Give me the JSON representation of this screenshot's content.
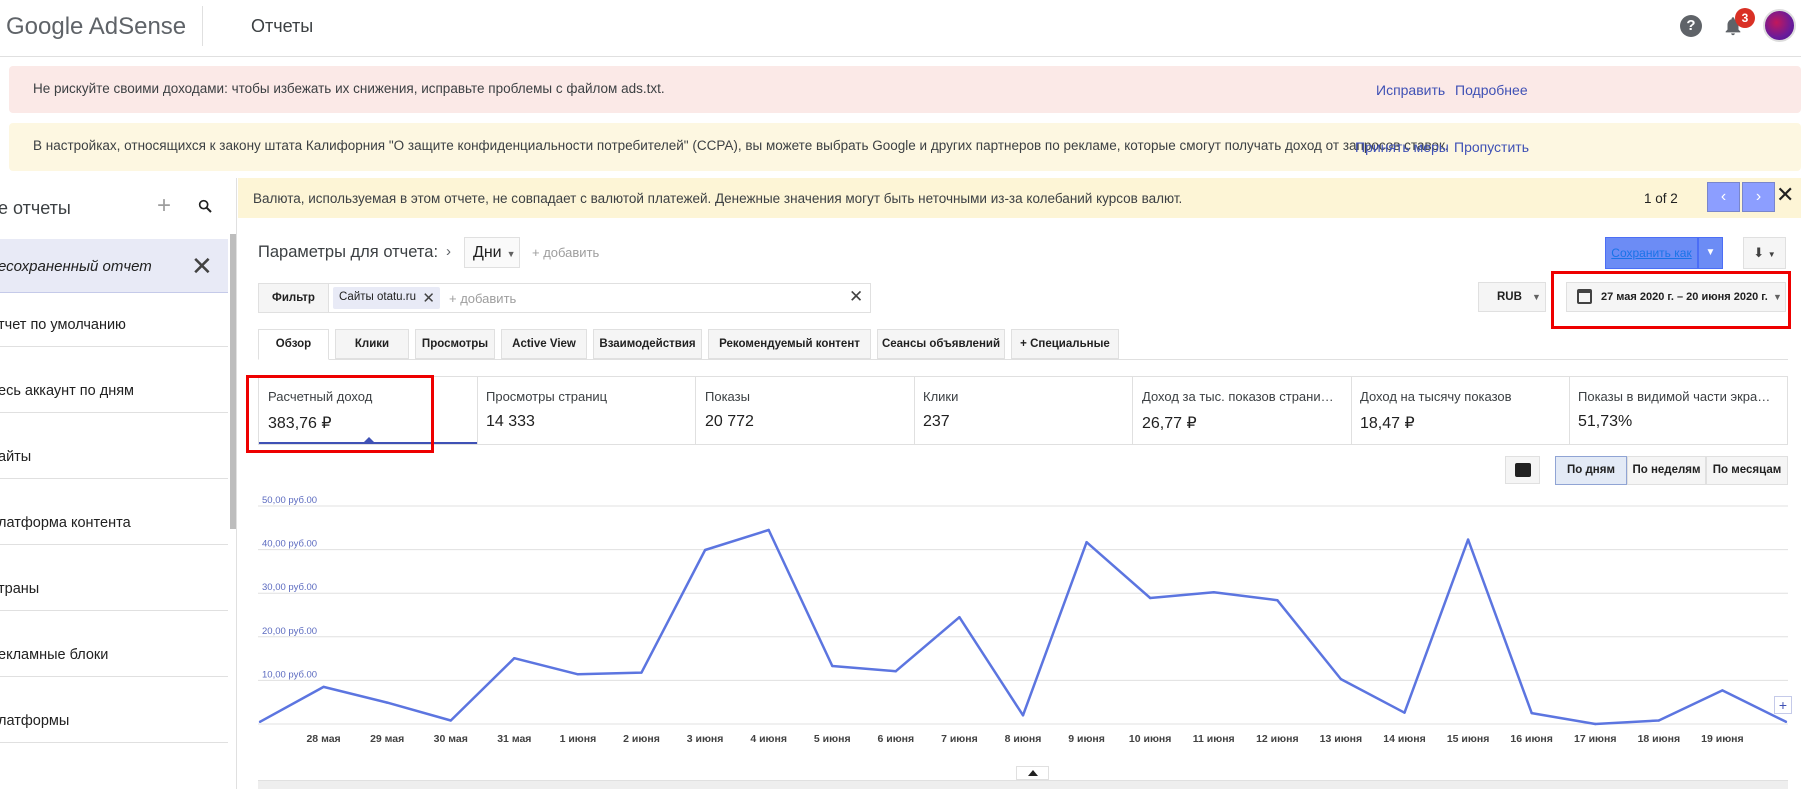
{
  "header": {
    "logo": "Google AdSense",
    "title": "Отчеты",
    "notification_count": "3",
    "help_label": "?"
  },
  "banners": [
    {
      "text": "Не рискуйте своими доходами: чтобы избежать их снижения, исправьте проблемы с файлом ads.txt.",
      "links": [
        "Исправить",
        "Подробнее"
      ]
    },
    {
      "text": "В настройках, относящихся к закону штата Калифорния \"О защите конфиденциальности потребителей\" (CCPA), вы можете выбрать Google и других партнеров по рекламе, которые смогут получать доход от запросов ставок.",
      "links": [
        "Принять меры",
        "Пропустить"
      ]
    }
  ],
  "sidebar": {
    "title": "е отчеты",
    "current": "есохраненный отчет",
    "items": [
      "тчет по умолчанию",
      "есь аккаунт по дням",
      "айты",
      "латформа контента",
      "траны",
      "екламные блоки",
      "латформы"
    ]
  },
  "currency_notice": {
    "text": "Валюта, используемая в этом отчете, не совпадает с валютой платежей. Денежные значения могут быть неточными из-за колебаний курсов валют.",
    "pager": "1 of 2",
    "prev": "‹",
    "next": "›",
    "close": "✕"
  },
  "params": {
    "label": "Параметры для отчета:",
    "chevron": "›",
    "dimension": "Дни",
    "add": "+ добавить",
    "save_label": "Сохранить как",
    "download_label": "⬇"
  },
  "filter": {
    "button": "Фильтр",
    "chip": "Сайты otatu.ru",
    "add": "+ добавить",
    "clear": "✕"
  },
  "currency_select": "RUB",
  "date_range": "27 мая 2020 г. – 20 июня 2020 г.",
  "tabs": [
    "Обзор",
    "Клики",
    "Просмотры",
    "Active View",
    "Взаимодействия",
    "Рекомендуемый контент",
    "Сеансы объявлений",
    "+  Специальные"
  ],
  "metrics": [
    {
      "label": "Расчетный доход",
      "value": "383,76 ₽"
    },
    {
      "label": "Просмотры страниц",
      "value": "14 333"
    },
    {
      "label": "Показы",
      "value": "20 772"
    },
    {
      "label": "Клики",
      "value": "237"
    },
    {
      "label": "Доход за тыс. показов страни…",
      "value": "26,77 ₽"
    },
    {
      "label": "Доход на тысячу показов",
      "value": "18,47 ₽"
    },
    {
      "label": "Показы в видимой части экра…",
      "value": "51,73%"
    }
  ],
  "granularity": [
    "По дням",
    "По неделям",
    "По месяцам"
  ],
  "colors": {
    "accent": "#3f51b5",
    "line": "#5c75e0",
    "highlight": "#ee0000"
  },
  "chart_data": {
    "type": "line",
    "x": [
      "27 мая",
      "28 мая",
      "29 мая",
      "30 мая",
      "31 мая",
      "1 июня",
      "2 июня",
      "3 июня",
      "4 июня",
      "5 июня",
      "6 июня",
      "7 июня",
      "8 июня",
      "9 июня",
      "10 июня",
      "11 июня",
      "12 июня",
      "13 июня",
      "14 июня",
      "15 июня",
      "16 июня",
      "17 июня",
      "18 июня",
      "19 июня",
      "20 июня"
    ],
    "tick_labels": [
      "28 мая",
      "29 мая",
      "30 мая",
      "31 мая",
      "1 июня",
      "2 июня",
      "3 июня",
      "4 июня",
      "5 июня",
      "6 июня",
      "7 июня",
      "8 июня",
      "9 июня",
      "10 июня",
      "11 июня",
      "12 июня",
      "13 июня",
      "14 июня",
      "15 июня",
      "16 июня",
      "17 июня",
      "18 июня",
      "19 июня"
    ],
    "series": [
      {
        "values": [
          0.5,
          8.5,
          4.9,
          0.8,
          15.1,
          11.4,
          11.8,
          39.9,
          44.5,
          13.3,
          12.1,
          24.5,
          2.0,
          41.7,
          28.9,
          30.2,
          28.4,
          10.3,
          2.6,
          42.3,
          2.5,
          0.0,
          0.8,
          7.7,
          0.5
        ]
      }
    ],
    "y_ticks": [
      "10,00 руб.00",
      "20,00 руб.00",
      "30,00 руб.00",
      "40,00 руб.00",
      "50,00 руб.00"
    ],
    "ylim": [
      0,
      50
    ],
    "grid": true
  }
}
